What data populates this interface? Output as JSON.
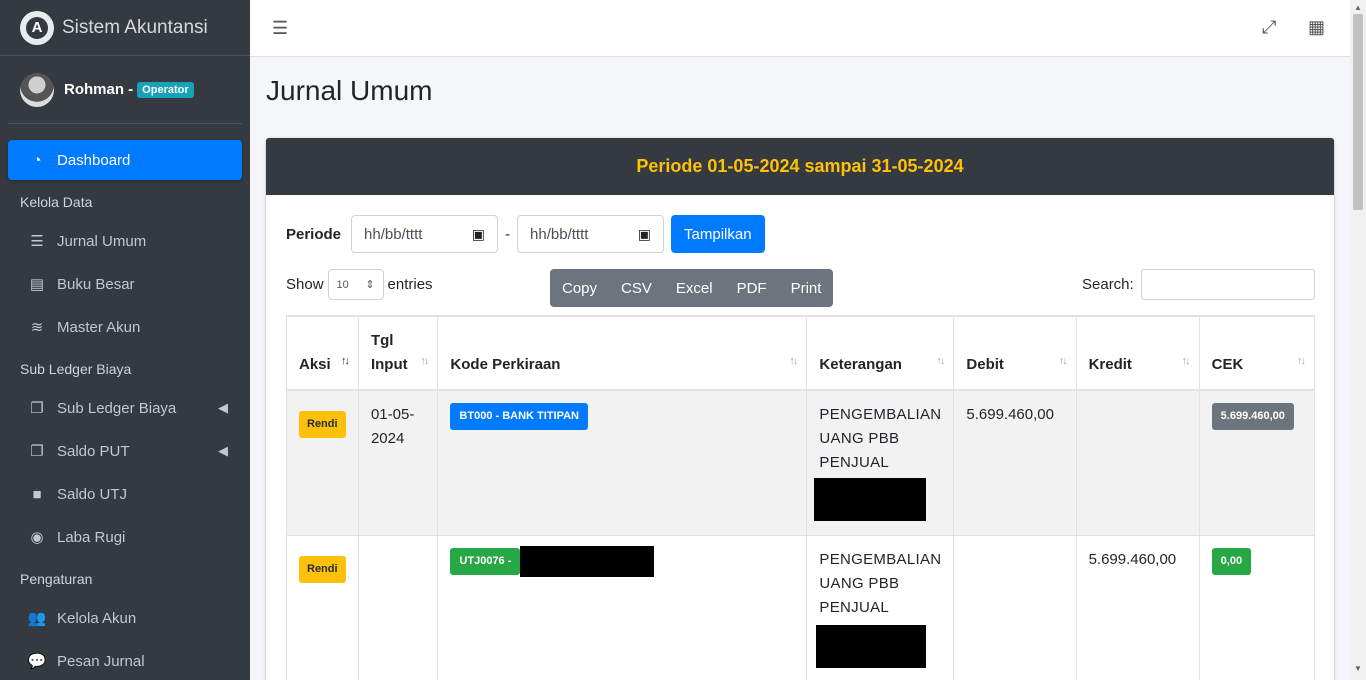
{
  "app": {
    "title": "Sistem Akuntansi",
    "logo_letter": "A"
  },
  "user": {
    "name": "Rohman -",
    "role": "Operator"
  },
  "sidebar": {
    "dashboard": "Dashboard",
    "header_kelola": "Kelola Data",
    "jurnal_umum": "Jurnal Umum",
    "buku_besar": "Buku Besar",
    "master_akun": "Master Akun",
    "header_subledger": "Sub Ledger Biaya",
    "sub_ledger_biaya": "Sub Ledger Biaya",
    "saldo_put": "Saldo PUT",
    "saldo_utj": "Saldo UTJ",
    "laba_rugi": "Laba Rugi",
    "header_pengaturan": "Pengaturan",
    "kelola_akun": "Kelola Akun",
    "pesan_jurnal": "Pesan Jurnal"
  },
  "page": {
    "title": "Jurnal Umum"
  },
  "card": {
    "header": "Periode 01-05-2024 sampai 31-05-2024"
  },
  "filter": {
    "label": "Periode",
    "start_placeholder": "hh/bb/tttt",
    "end_placeholder": "hh/bb/tttt",
    "separator": "-",
    "button": "Tampilkan"
  },
  "table_controls": {
    "show": "Show",
    "entries_value": "10",
    "entries": "entries",
    "buttons": [
      "Copy",
      "CSV",
      "Excel",
      "PDF",
      "Print"
    ],
    "search_label": "Search:"
  },
  "table": {
    "headers": [
      "Aksi",
      "Tgl Input",
      "Kode Perkiraan",
      "Keterangan",
      "Debit",
      "Kredit",
      "CEK"
    ],
    "rows": [
      {
        "aksi": "Rendi",
        "tgl": "01-05-2024",
        "kode": "BT000 - BANK TITIPAN",
        "ket": "PENGEMBALIAN UANG PBB PENJUAL",
        "debit": "5.699.460,00",
        "kredit": "",
        "cek": "5.699.460,00"
      },
      {
        "aksi": "Rendi",
        "tgl": "",
        "kode": "UTJ0076 -",
        "ket": "PENGEMBALIAN UANG PBB PENJUAL",
        "debit": "",
        "kredit": "5.699.460,00",
        "cek": "0,00"
      }
    ]
  },
  "colors": {
    "sidebar_bg": "#343a40",
    "primary": "#007bff",
    "warning": "#ffc107",
    "success": "#28a745",
    "secondary": "#6c757d"
  },
  "icons": [
    "menu-icon",
    "fullscreen-icon",
    "grid-icon",
    "dashboard-icon",
    "list-icon",
    "book-icon",
    "database-icon",
    "copy-icon",
    "square-icon",
    "dot-circle-icon",
    "users-icon",
    "comments-icon",
    "calendar-icon"
  ]
}
